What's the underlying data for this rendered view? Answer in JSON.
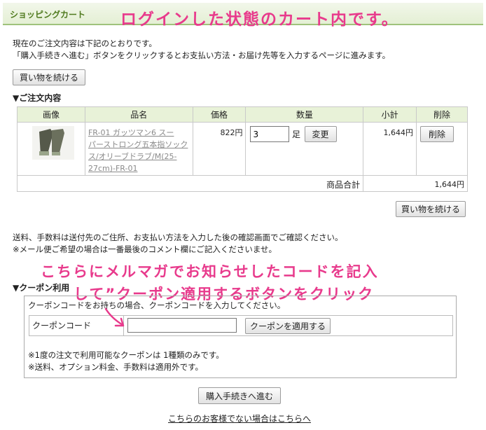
{
  "header": {
    "title": "ショッピングカート"
  },
  "annotations": {
    "top": "ログインした状態のカート内です。",
    "coupon_line1": "こちらにメルマガでお知らせしたコードを記入",
    "coupon_line2": "して”クーポン適用するボタンをクリック"
  },
  "intro": {
    "line1": "現在のご注文内容は下記のとおりです。",
    "line2": "「購入手続きへ進む」ボタンをクリックするとお支払い方法・お届け先等を入力するページに進みます。"
  },
  "continue_shopping_label": "買い物を続ける",
  "order_section_title": "▼ご注文内容",
  "cart_table": {
    "headers": [
      "画像",
      "品名",
      "価格",
      "数量",
      "小計",
      "削除"
    ],
    "items": [
      {
        "name_lines": [
          "FR-01 ガッツマン6 スー",
          "パーストロング五本指ソック",
          "ス/オリーブドラブ/M(25-",
          "27cm)-FR-01"
        ],
        "price": "822円",
        "quantity": "3",
        "unit": "足",
        "change_label": "変更",
        "subtotal": "1,644円",
        "delete_label": "削除"
      }
    ],
    "total_label": "商品合計",
    "total_value": "1,644円"
  },
  "notes": {
    "line1": "送料、手数料は送付先のご住所、お支払い方法を入力した後の確認画面でご確認ください。",
    "line2": "※メール便ご希望の場合は一番最後のコメント欄にご記入くださいませ。"
  },
  "coupon": {
    "section_title": "▼クーポン利用",
    "instruction": "クーポンコードをお持ちの場合、クーポンコードを入力してください。",
    "code_label": "クーポンコード",
    "code_value": "",
    "apply_label": "クーポンを適用する",
    "note1": "※1度の注文で利用可能なクーポンは 1種類のみです。",
    "note2": "※送料、オプション料金、手数料は適用外です。"
  },
  "checkout_label": "購入手続きへ進む",
  "footer_link": "こちらのお客様でない場合はこちらへ",
  "colors": {
    "accent_green": "#9fc27b",
    "annotation_pink": "#e83a8c",
    "table_header_bg": "#e8f2d8"
  }
}
